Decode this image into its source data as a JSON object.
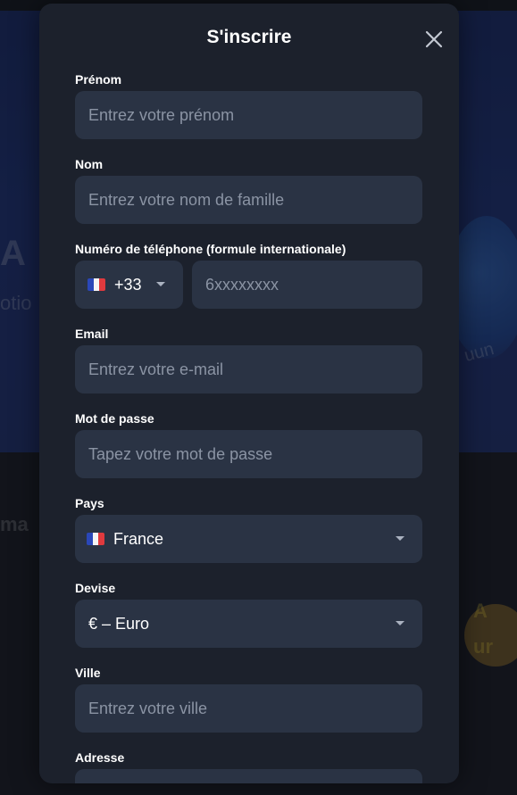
{
  "background": {
    "ghost_texts": [
      "A",
      "otio",
      "ma",
      "uun",
      "A",
      "ur"
    ]
  },
  "modal": {
    "title": "S'inscrire",
    "close_icon": "close-icon"
  },
  "fields": {
    "first_name": {
      "label": "Prénom",
      "placeholder": "Entrez votre prénom"
    },
    "last_name": {
      "label": "Nom",
      "placeholder": "Entrez votre nom de famille"
    },
    "phone": {
      "label": "Numéro de téléphone (formule internationale)",
      "country_code": "+33",
      "flag_icon": "france-flag-icon",
      "placeholder": "6xxxxxxxx"
    },
    "email": {
      "label": "Email",
      "placeholder": "Entrez votre e-mail"
    },
    "password": {
      "label": "Mot de passe",
      "placeholder": "Tapez votre mot de passe"
    },
    "country": {
      "label": "Pays",
      "value": "France",
      "flag_icon": "france-flag-icon"
    },
    "currency": {
      "label": "Devise",
      "value": "€ – Euro"
    },
    "city": {
      "label": "Ville",
      "placeholder": "Entrez votre ville"
    },
    "address": {
      "label": "Adresse"
    }
  },
  "colors": {
    "modal_bg": "#1c212c",
    "input_bg": "#2a3344",
    "placeholder": "#8b94a4",
    "text": "#ffffff",
    "banner_bg": "#1e3170"
  }
}
